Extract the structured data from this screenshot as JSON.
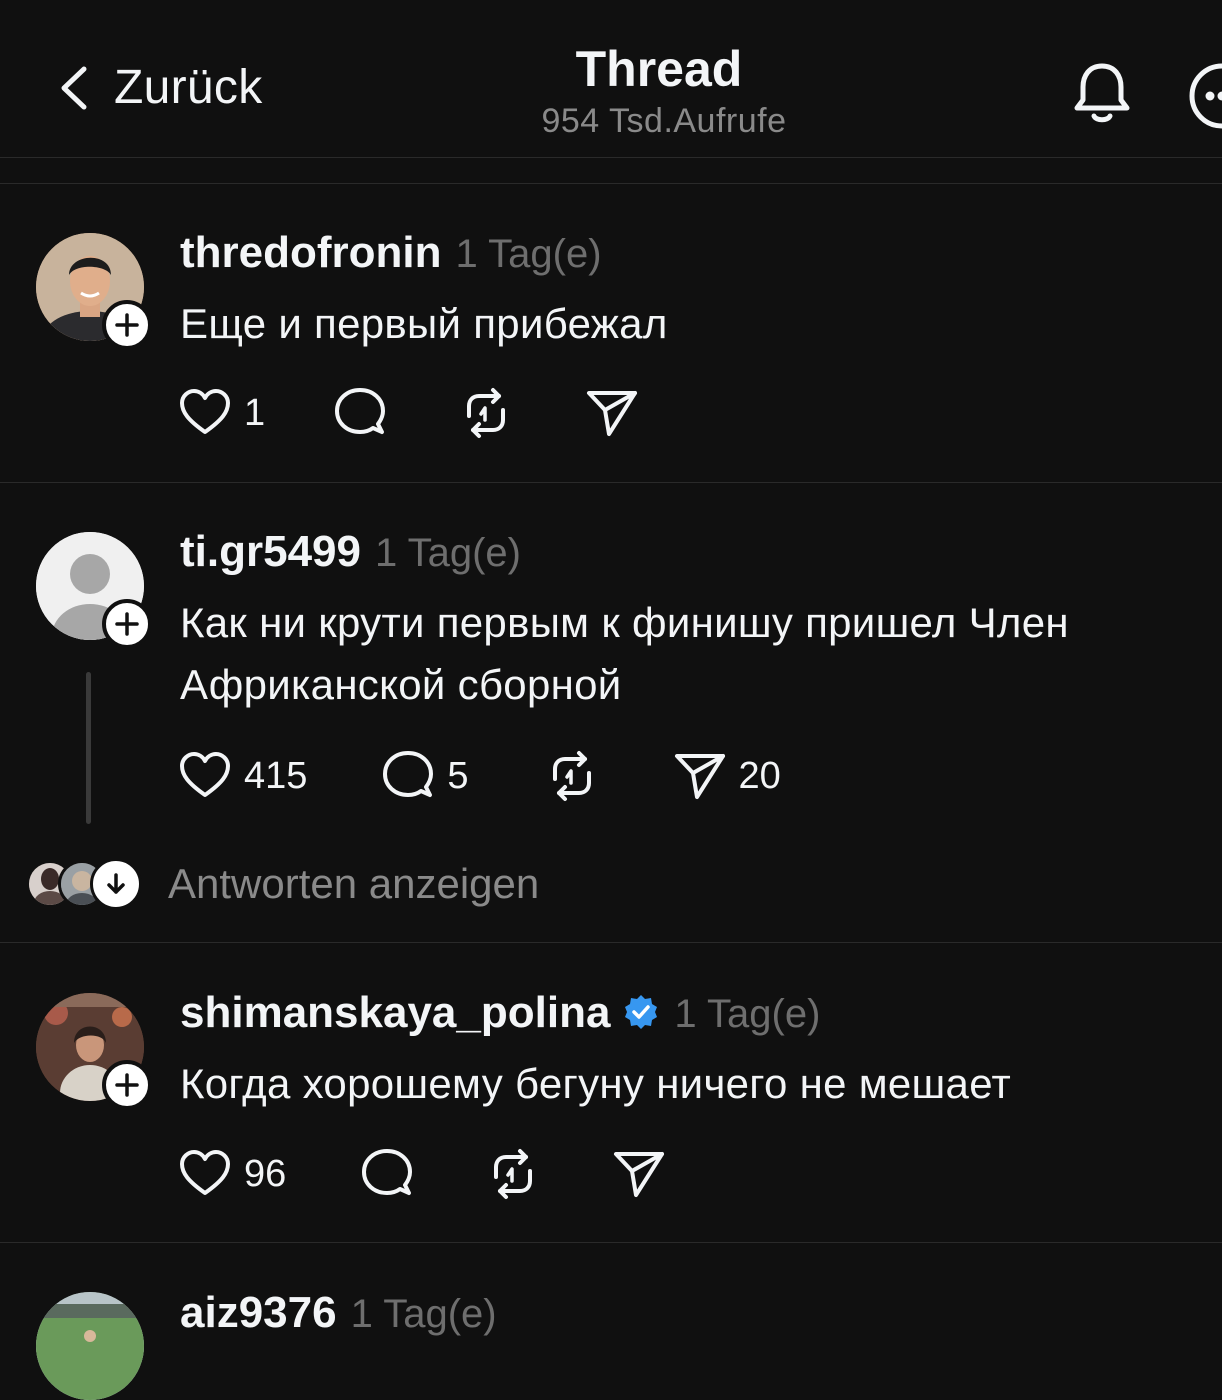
{
  "header": {
    "back_label": "Zurück",
    "title": "Thread",
    "views": "954 Tsd.Aufrufe"
  },
  "posts": [
    {
      "username": "thredofronin",
      "time": "1 Tag(e)",
      "text": "Еще и первый прибежал",
      "likes": "1",
      "comments": "",
      "shares": ""
    },
    {
      "username": "ti.gr5499",
      "time": "1 Tag(e)",
      "text": "Как ни крути первым к финишу пришел Член Африканской сборной",
      "likes": "415",
      "comments": "5",
      "shares": "20"
    },
    {
      "username": "shimanskaya_polina",
      "verified": true,
      "time": "1 Tag(e)",
      "text": "Когда хорошему бегуну ничего не мешает",
      "likes": "96",
      "comments": "",
      "shares": ""
    },
    {
      "username": "aiz9376",
      "time": "1 Tag(e)"
    }
  ],
  "replies_label": "Antworten anzeigen",
  "icons": [
    "chevron-left-icon",
    "bell-icon",
    "more-icon",
    "heart-icon",
    "comment-icon",
    "repost-icon",
    "share-icon",
    "plus-icon",
    "verified-icon",
    "arrow-down-icon"
  ],
  "colors": {
    "background": "#101010",
    "text": "#f3f5f7",
    "muted": "#6e6e6e",
    "verified": "#3797f0"
  }
}
